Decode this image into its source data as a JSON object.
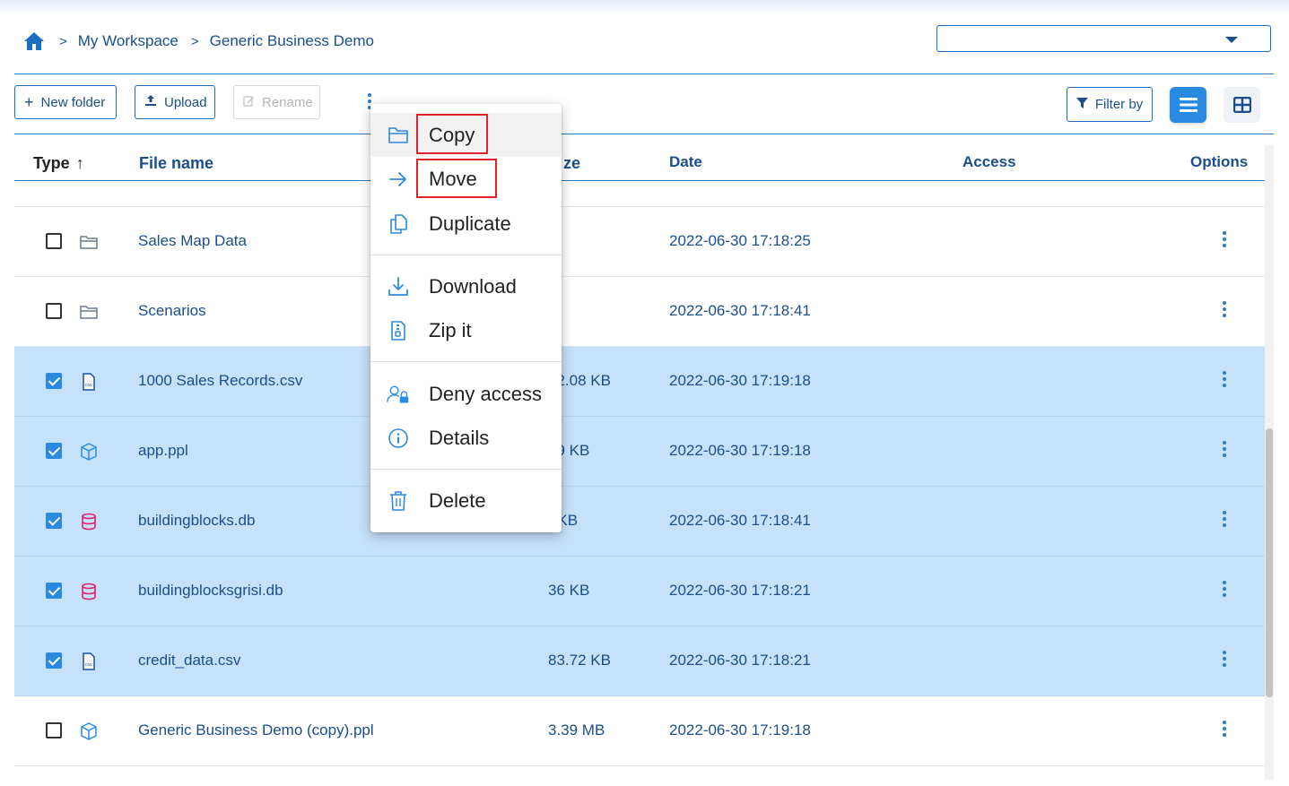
{
  "breadcrumb": {
    "items": [
      "My Workspace",
      "Generic Business Demo"
    ],
    "separator": ">"
  },
  "workspace_select": {
    "value": ""
  },
  "toolbar": {
    "new_folder": "New folder",
    "upload": "Upload",
    "rename": "Rename",
    "filter": "Filter by"
  },
  "table": {
    "headers": {
      "type": "Type",
      "type_sort": "↑",
      "file_name": "File name",
      "size": "Size",
      "size_visible": "ze",
      "date": "Date",
      "access": "Access",
      "options": "Options"
    },
    "rows": [
      {
        "name": "Sales Map Data",
        "size": "",
        "date": "2022-06-30 17:18:25",
        "type": "folder",
        "selected": false
      },
      {
        "name": "Scenarios",
        "size": "",
        "date": "2022-06-30 17:18:41",
        "type": "folder",
        "selected": false
      },
      {
        "name": "1000 Sales Records.csv",
        "size": "22.08 KB",
        "size_visible": "22.08 KB",
        "date": "2022-06-30 17:19:18",
        "type": "csv",
        "selected": true
      },
      {
        "name": "app.ppl",
        "size": "29 KB",
        "size_visible": "29 KB",
        "date": "2022-06-30 17:19:18",
        "type": "ppl",
        "selected": true
      },
      {
        "name": "buildingblocks.db",
        "size": "0 KB",
        "size_visible": ") KB",
        "date": "2022-06-30 17:18:41",
        "type": "db",
        "selected": true
      },
      {
        "name": "buildingblocksgrisi.db",
        "size": "36 KB",
        "size_visible": "36 KB",
        "date": "2022-06-30 17:18:21",
        "type": "db",
        "selected": true
      },
      {
        "name": "credit_data.csv",
        "size": "83.72 KB",
        "size_visible": "83.72 KB",
        "date": "2022-06-30 17:18:21",
        "type": "csv",
        "selected": true
      },
      {
        "name": "Generic Business Demo (copy).ppl",
        "size": "3.39 MB",
        "size_visible": "3.39 MB",
        "date": "2022-06-30 17:19:18",
        "type": "ppl",
        "selected": false
      }
    ]
  },
  "context_menu": {
    "items": [
      "Copy",
      "Move",
      "Duplicate",
      "Download",
      "Zip it",
      "Deny access",
      "Details",
      "Delete"
    ]
  },
  "colors": {
    "primary": "#1a4f8b",
    "accent": "#2a8ae2",
    "selected_row": "#c6e1fa",
    "db_icon": "#e0206a",
    "highlight_box": "#e0222b"
  },
  "icons": {
    "home": "home-icon",
    "folder": "folder-icon",
    "csv": "csv-file-icon",
    "ppl": "cube-icon",
    "db": "database-icon"
  }
}
